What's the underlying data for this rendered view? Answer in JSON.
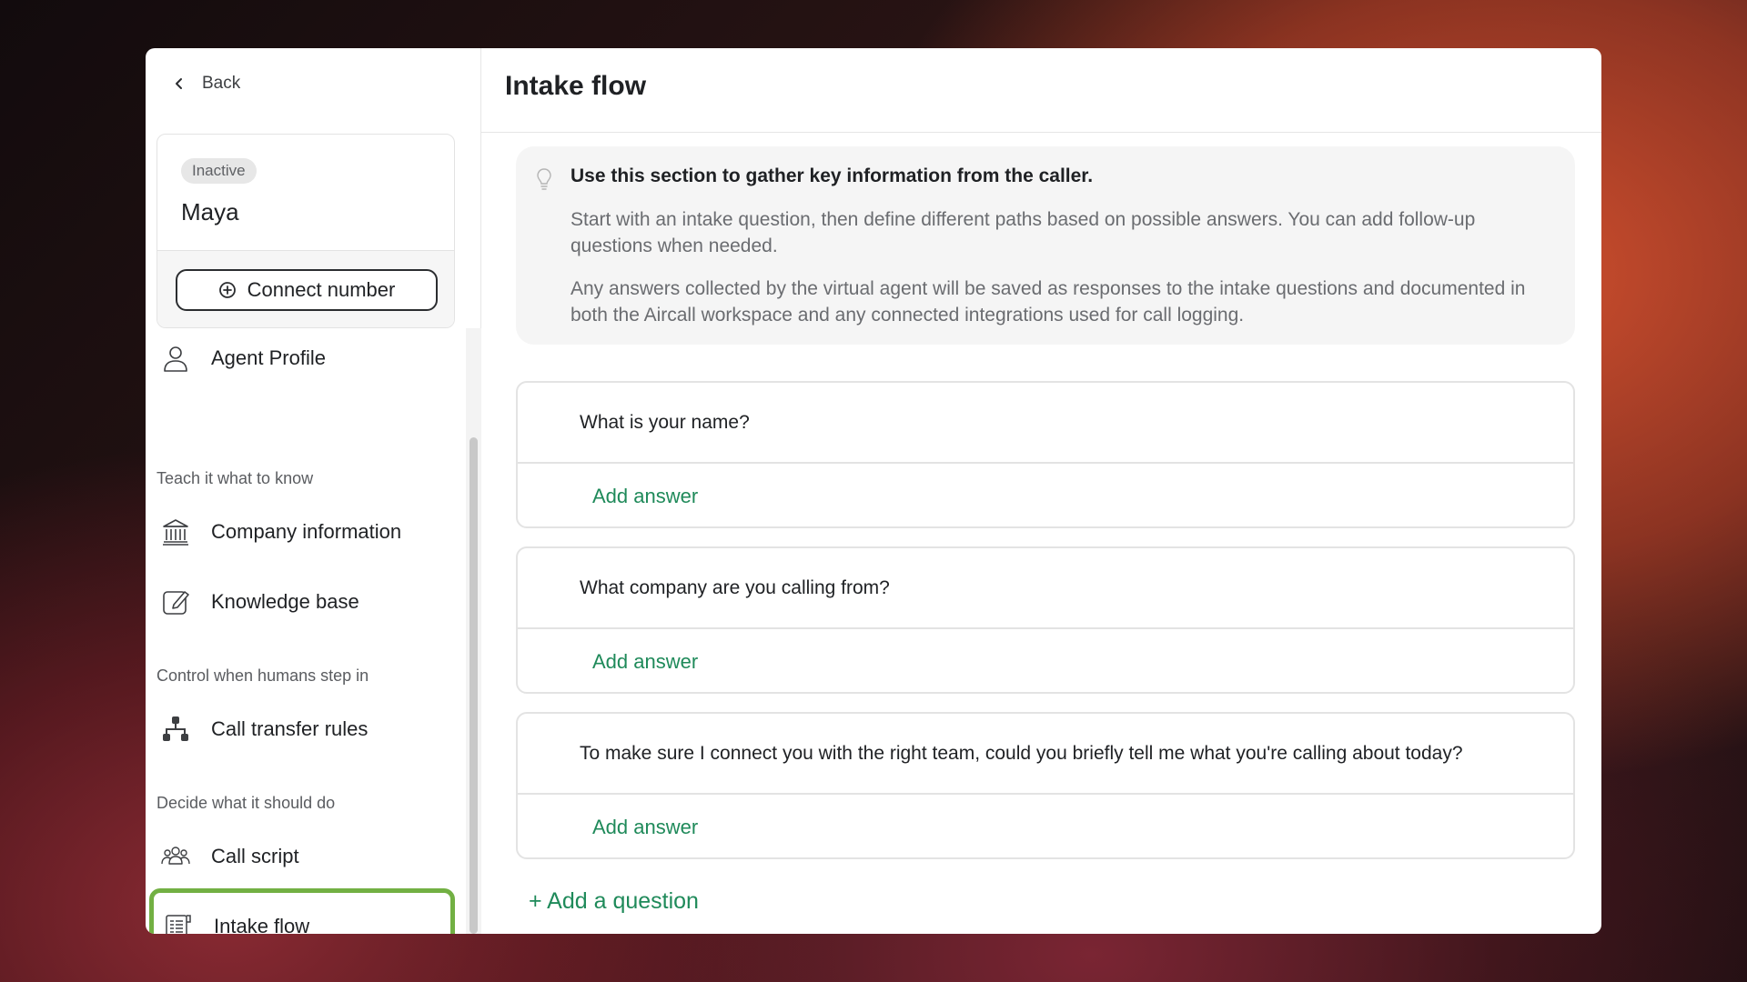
{
  "sidebar": {
    "back_label": "Back",
    "agent": {
      "status": "Inactive",
      "name": "Maya",
      "connect_label": "Connect number"
    },
    "items": {
      "agent_profile": "Agent Profile",
      "section_know": "Teach it what to know",
      "company_info": "Company information",
      "knowledge_base": "Knowledge base",
      "section_humans": "Control when humans step in",
      "call_transfer": "Call transfer rules",
      "section_do": "Decide what it should do",
      "call_script": "Call script",
      "intake_flow": "Intake flow"
    }
  },
  "main": {
    "title": "Intake flow",
    "info": {
      "title": "Use this section to gather key information from the caller.",
      "p1": "Start with an intake question, then define different paths based on possible answers. You can add follow-up questions when needed.",
      "p2": "Any answers collected by the virtual agent will be saved as responses to the intake questions and documented in both the Aircall workspace and any connected integrations used for call logging."
    },
    "questions": [
      {
        "question": "What is your name?",
        "add_answer": "Add answer"
      },
      {
        "question": "What company are you calling from?",
        "add_answer": "Add answer"
      },
      {
        "question": "To make sure I connect you with the right team, could you briefly tell me what you're calling about today?",
        "add_answer": "Add answer"
      }
    ],
    "add_question_label": "+ Add a question"
  },
  "colors": {
    "accent_green": "#1f8a5a",
    "active_outline": "#72b043"
  }
}
